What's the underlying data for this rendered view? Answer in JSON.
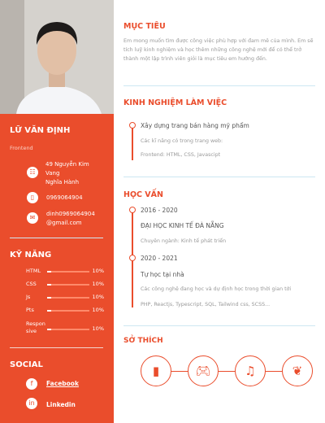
{
  "profile": {
    "name": "LỮ VĂN ĐỊNH",
    "role": "Frontend",
    "address": [
      "49 Nguyễn Kim",
      "Vang",
      "Nghĩa Hành"
    ],
    "phone": "0969064904",
    "email": [
      "dinh0969064904",
      "@gmail.com"
    ]
  },
  "skills": {
    "title": "KỸ NĂNG",
    "items": [
      {
        "name": "HTML",
        "percent": 10,
        "label": "10%"
      },
      {
        "name": "CSS",
        "percent": 10,
        "label": "10%"
      },
      {
        "name": "Js",
        "percent": 10,
        "label": "10%"
      },
      {
        "name": "Pts",
        "percent": 10,
        "label": "10%"
      },
      {
        "name": "Respon sive",
        "percent": 10,
        "label": "10%"
      }
    ]
  },
  "social": {
    "title": "SOCIAL",
    "facebook": "Facebook",
    "linkedin": "Linkedin"
  },
  "objective": {
    "title": "MỤC TIÊU",
    "text": "Em mong muốn tìm được công việc phù hợp với đam mê của mình. Em sẽ tích luỹ kinh nghiệm và học thêm những công nghệ mới để có thể trở thành một lập trình viên giỏi là mục tiêu em hướng đến."
  },
  "experience": {
    "title": "KINH NGHIỆM LÀM VIỆC",
    "project": "Xây dựng trang bán hàng mỹ phẩm",
    "line1": "Các kĩ năng có trong trang web:",
    "line2": "Frontend: HTML, CSS, Javascipt"
  },
  "education": {
    "title": "HỌC VẤN",
    "items": [
      {
        "years": "2016 - 2020",
        "school": "ĐẠI HỌC KINH TẾ ĐÀ NẴNG",
        "detail": "Chuyên ngành: Kinh tế phát triển"
      },
      {
        "years": "2020 - 2021",
        "school": "Tự học tại nhà",
        "detail": "Các công nghệ đang học và dự định học trong thời gian tới",
        "detail2": "PHP, Reactjs, Typescript, SQL, Tailwind css, SCSS..."
      }
    ]
  },
  "hobbies": {
    "title": "SỞ THÍCH",
    "items": [
      "book-icon",
      "gamepad-icon",
      "music-icon",
      "leaf-icon"
    ]
  },
  "colors": {
    "accent": "#ea4d2c"
  }
}
